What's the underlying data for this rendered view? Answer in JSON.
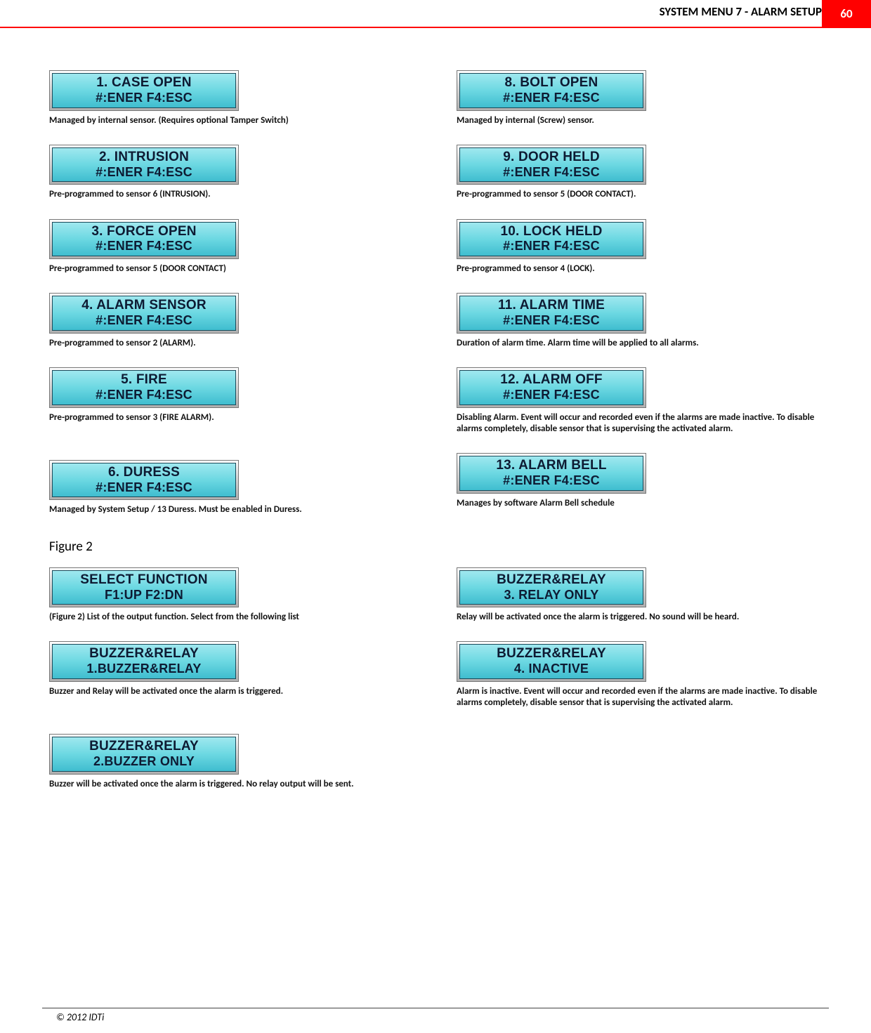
{
  "header": {
    "title": "SYSTEM MENU 7 - ALARM SETUP",
    "page": "60"
  },
  "common": {
    "enter_esc": "#:ENER  F4:ESC"
  },
  "left": {
    "items": [
      {
        "line1": "1. CASE OPEN",
        "desc": "Managed by internal sensor. (Requires optional Tamper Switch)"
      },
      {
        "line1": "2. INTRUSION",
        "desc": "Pre-programmed to sensor 6 (INTRUSION)."
      },
      {
        "line1": "3. FORCE OPEN",
        "desc": "Pre-programmed to sensor 5 (DOOR CONTACT)"
      },
      {
        "line1": "4. ALARM SENSOR",
        "desc": "Pre-programmed to sensor 2 (ALARM)."
      },
      {
        "line1": "5. FIRE",
        "desc": "Pre-programmed to sensor 3 (FIRE ALARM)."
      },
      {
        "line1": "6. DURESS",
        "desc": "Managed by System Setup / 13 Duress. Must be enabled in Duress."
      }
    ]
  },
  "right": {
    "items": [
      {
        "line1": "8. BOLT OPEN",
        "desc": "Managed by internal (Screw) sensor."
      },
      {
        "line1": "9. DOOR HELD",
        "desc": "Pre-programmed to sensor 5 (DOOR CONTACT)."
      },
      {
        "line1": "10. LOCK HELD",
        "desc": "Pre-programmed to sensor 4 (LOCK)."
      },
      {
        "line1": "11. ALARM TIME",
        "desc": "Duration of alarm time. Alarm time will be applied to all alarms."
      },
      {
        "line1": "12. ALARM OFF",
        "desc": "Disabling Alarm. Event will occur and recorded even if the alarms are made inactive. To disable alarms completely, disable sensor that is supervising the activated alarm."
      },
      {
        "line1": "13. ALARM BELL",
        "desc": "Manages by software Alarm Bell schedule"
      }
    ]
  },
  "figure_label": "Figure 2",
  "figure2_left": {
    "items": [
      {
        "line1": "SELECT FUNCTION",
        "line2": "F1:UP    F2:DN",
        "desc": "(Figure 2) List of the output function. Select from the following list"
      },
      {
        "line1": "BUZZER&RELAY",
        "line2": "1.BUZZER&RELAY",
        "desc": "Buzzer and Relay will be activated once the alarm is triggered."
      },
      {
        "line1": "BUZZER&RELAY",
        "line2": "2.BUZZER ONLY",
        "desc": "Buzzer will be activated once the alarm is triggered. No relay output will be sent."
      }
    ]
  },
  "figure2_right": {
    "items": [
      {
        "line1": "BUZZER&RELAY",
        "line2": "3. RELAY ONLY",
        "desc": "Relay will be activated once the alarm is triggered. No sound will be heard."
      },
      {
        "line1": "BUZZER&RELAY",
        "line2": "4. INACTIVE",
        "desc": "Alarm is inactive. Event will occur and recorded even if the alarms are made inactive. To disable alarms completely, disable sensor that is supervising the activated alarm."
      }
    ]
  },
  "footer": "© 2012 IDTi"
}
